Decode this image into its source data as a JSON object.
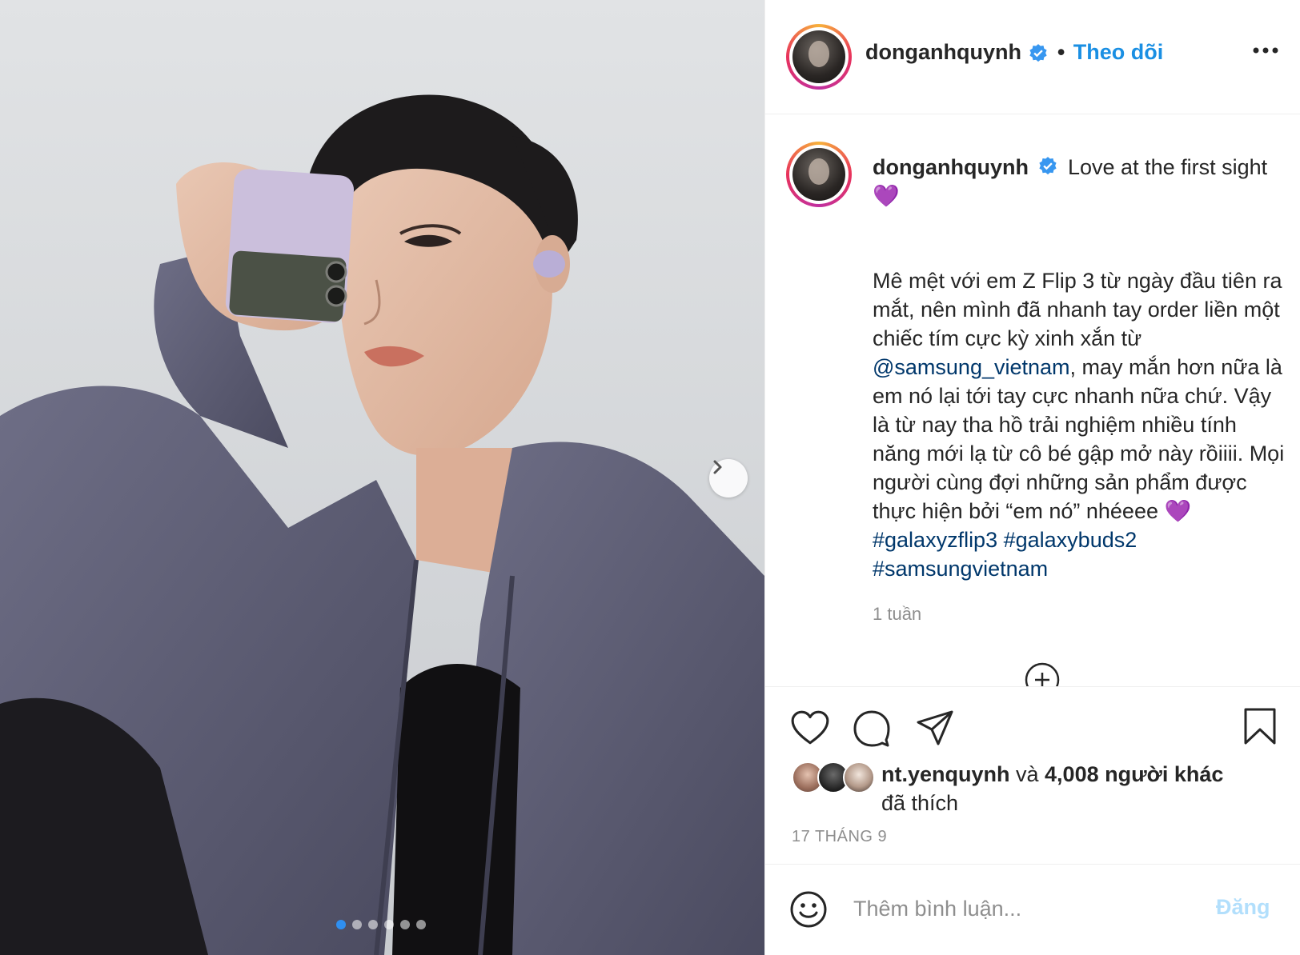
{
  "post": {
    "username": "donganhquynh",
    "follow_label": "Theo dõi",
    "separator": "•",
    "caption_first": "Love at the first sight",
    "caption_heart": "💜",
    "caption_body_1": "Mê mệt với em Z Flip 3 từ ngày đầu tiên ra mắt, nên mình đã nhanh tay order liền một chiếc tím cực kỳ xinh xắn từ ",
    "mention": "@samsung_vietnam",
    "caption_body_2": ", may mắn hơn nữa là em nó lại tới tay cực nhanh nữa chứ. Vậy là từ nay tha hồ trải nghiệm nhiều tính năng mới lạ từ cô bé gập mở này rồiiii. Mọi người cùng đợi những sản phẩm được thực hiện bởi “em nó” nhéeee ",
    "hashtag_1": "#galaxyzflip3",
    "hashtag_2": "#galaxybuds2",
    "hashtag_3": "#samsungvietnam",
    "time_ago": "1 tuần",
    "liker": "nt.yenquynh",
    "likes_and": " và ",
    "likes_count": "4,008 người khác",
    "likes_suffix": "đã thích",
    "date": "17 THÁNG 9",
    "comment_placeholder": "Thêm bình luận...",
    "post_label": "Đăng"
  },
  "carousel": {
    "total": 6,
    "active": 1
  },
  "colors": {
    "accent": "#1a8fe3",
    "verified": "#3897f0",
    "link": "#00376b",
    "heart": "#a64de8",
    "dot_active": "#2f8ff0"
  },
  "icons": [
    "verified-icon",
    "more-options-icon",
    "next-arrow-icon",
    "load-more-icon",
    "heart-icon",
    "comment-icon",
    "share-icon",
    "bookmark-icon",
    "emoji-icon"
  ]
}
